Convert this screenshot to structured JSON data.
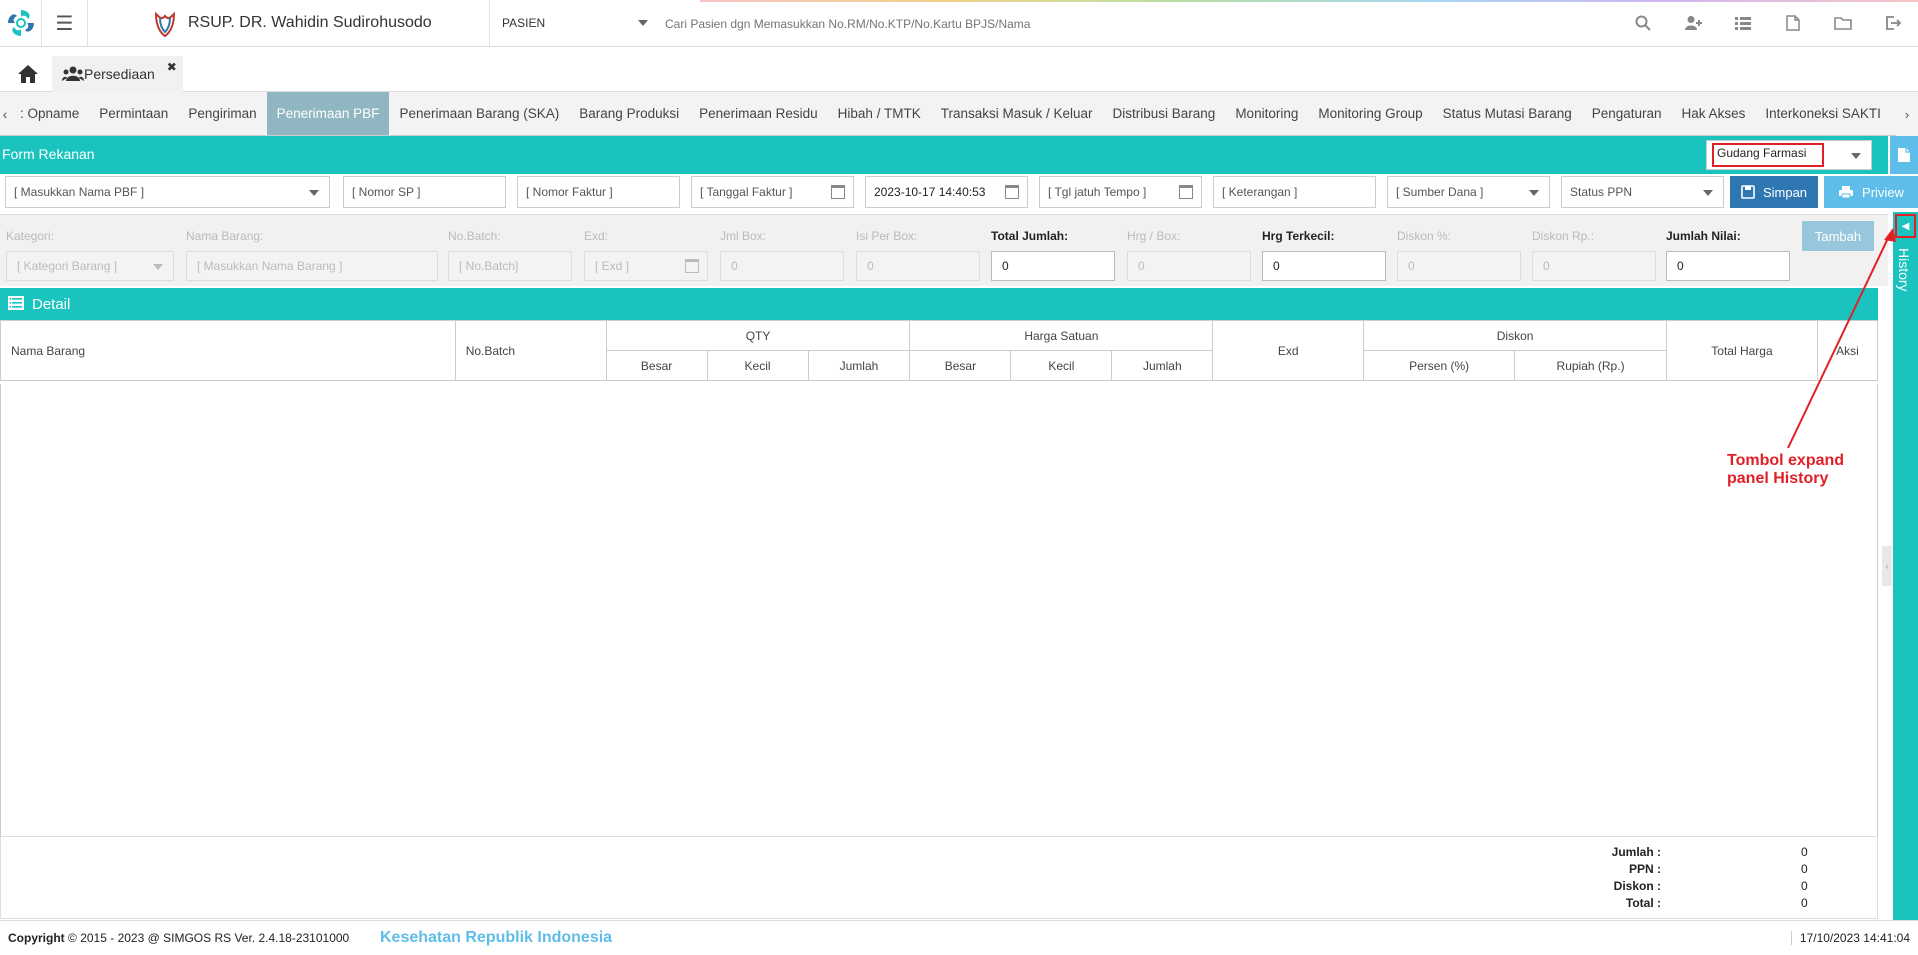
{
  "topbar": {
    "hospital_name": "RSUP. DR. Wahidin Sudirohusodo",
    "mode": "PASIEN",
    "search_placeholder": "Cari Pasien dgn Memasukkan No.RM/No.KTP/No.Kartu BPJS/Nama",
    "icons": [
      "search-icon",
      "add-user-icon",
      "list-icon",
      "pdf-icon",
      "folder-icon",
      "logout-icon"
    ]
  },
  "tabs": {
    "app_tab": "Persediaan"
  },
  "modnav": {
    "items": [
      ": Opname",
      "Permintaan",
      "Pengiriman",
      "Penerimaan PBF",
      "Penerimaan Barang (SKA)",
      "Barang Produksi",
      "Penerimaan Residu",
      "Hibah / TMTK",
      "Transaksi Masuk / Keluar",
      "Distribusi Barang",
      "Monitoring",
      "Monitoring Group",
      "Status Mutasi Barang",
      "Pengaturan",
      "Hak Akses",
      "Interkoneksi SAKTI"
    ],
    "active": "Penerimaan PBF"
  },
  "form": {
    "title": "Form Rekanan",
    "gudang": "Gudang Farmasi",
    "pbf_placeholder": "[ Masukkan Nama PBF ]",
    "nomor_sp": "[ Nomor SP ]",
    "nomor_faktur": "[ Nomor Faktur ]",
    "tanggal_faktur": "[ Tanggal Faktur ]",
    "tanggal_value": "2023-10-17 14:40:53",
    "tgl_jatuh_tempo": "[ Tgl jatuh Tempo ]",
    "keterangan": "[ Keterangan ]",
    "sumber_dana": "[ Sumber Dana ]",
    "status_ppn": "Status PPN",
    "simpan": "Simpan",
    "priview": "Priview"
  },
  "entry": {
    "kategori_label": "Kategori:",
    "kategori_ph": "[ Kategori Barang ]",
    "nama_label": "Nama Barang:",
    "nama_ph": "[ Masukkan Nama Barang ]",
    "batch_label": "No.Batch:",
    "batch_ph": "[ No.Batch]",
    "exd_label": "Exd:",
    "exd_ph": "[ Exd ]",
    "jml_box_label": "Jml Box:",
    "jml_box": "0",
    "isi_box_label": "Isi Per Box:",
    "isi_box": "0",
    "total_jumlah_label": "Total Jumlah:",
    "total_jumlah": "0",
    "hrg_box_label": "Hrg / Box:",
    "hrg_box": "0",
    "hrg_terkecil_label": "Hrg Terkecil:",
    "hrg_terkecil": "0",
    "diskon_pct_label": "Diskon %:",
    "diskon_pct": "0",
    "diskon_rp_label": "Diskon Rp.:",
    "diskon_rp": "0",
    "jumlah_nilai_label": "Jumlah Nilai:",
    "jumlah_nilai": "0",
    "tambah": "Tambah"
  },
  "detail": {
    "title": "Detail",
    "headers": {
      "nama_barang": "Nama Barang",
      "no_batch": "No.Batch",
      "qty": "QTY",
      "harga_satuan": "Harga Satuan",
      "exd": "Exd",
      "diskon": "Diskon",
      "total_harga": "Total Harga",
      "aksi": "Aksi",
      "besar": "Besar",
      "kecil": "Kecil",
      "jumlah": "Jumlah",
      "persen": "Persen (%)",
      "rupiah": "Rupiah (Rp.)"
    },
    "totals": {
      "jumlah_label": "Jumlah :",
      "jumlah": "0",
      "ppn_label": "PPN :",
      "ppn": "0",
      "diskon_label": "Diskon :",
      "diskon": "0",
      "total_label": "Total :",
      "total": "0"
    }
  },
  "history": {
    "label": "History"
  },
  "annotation": {
    "line1": "Tombol expand",
    "line2": "panel History",
    "color": "#e01f26"
  },
  "footer": {
    "copyright_bold": "Copyright",
    "copyright": "2015 - 2023 @ SIMGOS RS Ver. 2.4.18-23101000",
    "kesehatan": "Kesehatan Republik Indonesia",
    "timestamp": "17/10/2023 14:41:04"
  },
  "colors": {
    "teal": "#1bc3bf",
    "active_tab": "#8fb6c1",
    "simpan": "#2f77b3",
    "priview": "#5fbde9"
  }
}
